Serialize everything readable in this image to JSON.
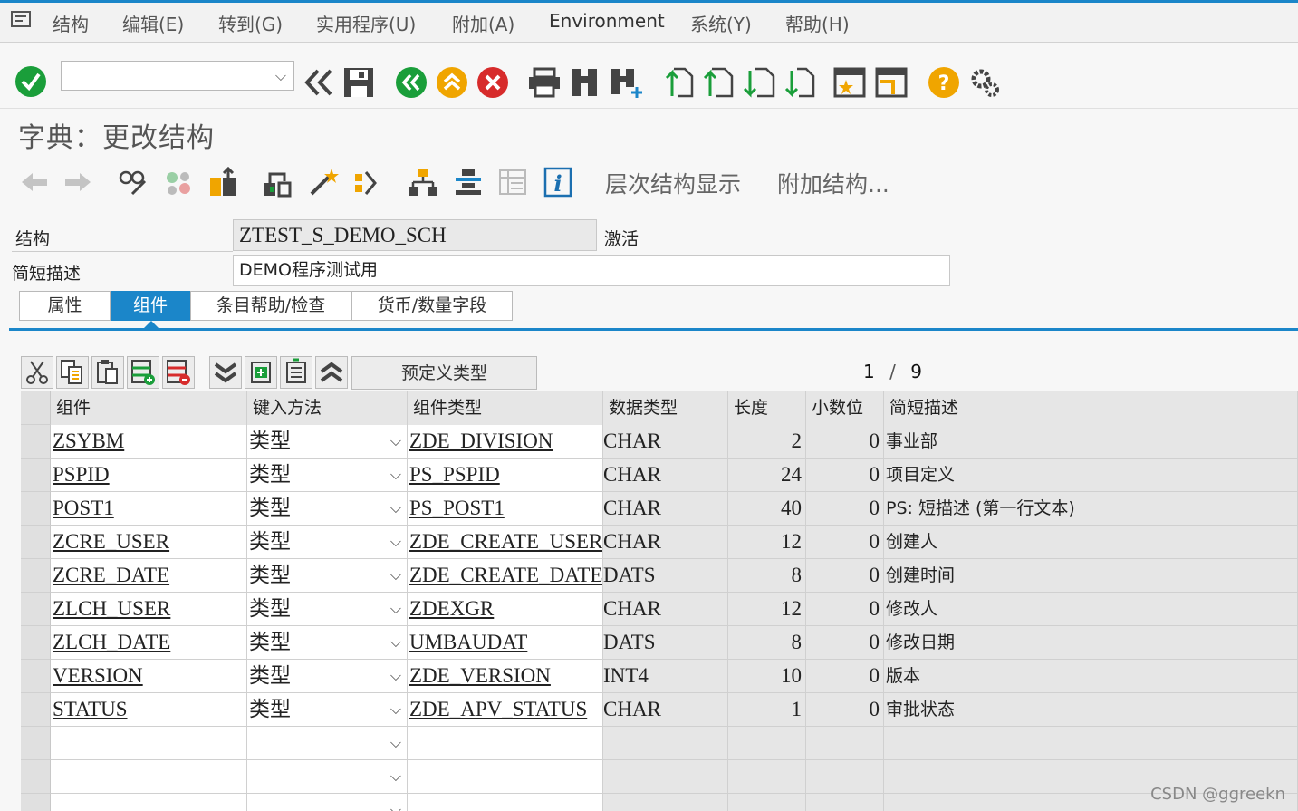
{
  "menubar": {
    "items": [
      "结构(S)",
      "编辑(E)",
      "转到(G)",
      "实用程序(U)",
      "附加(A)",
      "Environment",
      "系统(Y)",
      "帮助(H)"
    ],
    "display": [
      "结构",
      "编辑(E)",
      "转到(G)",
      "实用程序(U)",
      "附加(A)",
      "Environment",
      "系统(Y)",
      "帮助(H)"
    ]
  },
  "command_field": {
    "value": ""
  },
  "title": "字典：更改结构",
  "app_toolbar": {
    "hierarchy_label": "层次结构显示",
    "append_label": "附加结构..."
  },
  "header": {
    "structure_label": "结构",
    "structure_value": "ZTEST_S_DEMO_SCH",
    "status": "激活",
    "short_desc_label": "简短描述",
    "short_desc_value": "DEMO程序测试用"
  },
  "tabs": [
    "属性",
    "组件",
    "条目帮助/检查",
    "货币/数量字段"
  ],
  "table_toolbar": {
    "predefined_type": "预定义类型",
    "pager_current": "1",
    "pager_sep": "/",
    "pager_total": "9"
  },
  "grid": {
    "columns": [
      "组件",
      "键入方法",
      "组件类型",
      "数据类型",
      "长度",
      "小数位",
      "简短描述"
    ],
    "rows": [
      [
        "ZSYBM",
        "类型",
        "ZDE_DIVISION",
        "CHAR",
        "2",
        "0",
        "事业部"
      ],
      [
        "PSPID",
        "类型",
        "PS_PSPID",
        "CHAR",
        "24",
        "0",
        "项目定义"
      ],
      [
        "POST1",
        "类型",
        "PS_POST1",
        "CHAR",
        "40",
        "0",
        "PS: 短描述 (第一行文本)"
      ],
      [
        "ZCRE_USER",
        "类型",
        "ZDE_CREATE_USER",
        "CHAR",
        "12",
        "0",
        "创建人"
      ],
      [
        "ZCRE_DATE",
        "类型",
        "ZDE_CREATE_DATE",
        "DATS",
        "8",
        "0",
        "创建时间"
      ],
      [
        "ZLCH_USER",
        "类型",
        "ZDEXGR",
        "CHAR",
        "12",
        "0",
        "修改人"
      ],
      [
        "ZLCH_DATE",
        "类型",
        "UMBAUDAT",
        "DATS",
        "8",
        "0",
        "修改日期"
      ],
      [
        "VERSION",
        "类型",
        "ZDE_VERSION",
        "INT4",
        "10",
        "0",
        "版本"
      ],
      [
        "STATUS",
        "类型",
        "ZDE_APV_STATUS",
        "CHAR",
        "1",
        "0",
        "审批状态"
      ]
    ]
  },
  "watermark": "CSDN @ggreekn",
  "colors": {
    "accent": "#1b86c9",
    "ok_green": "#1a9e3a",
    "cancel_red": "#d72b2b",
    "help_yellow": "#f0a500"
  }
}
